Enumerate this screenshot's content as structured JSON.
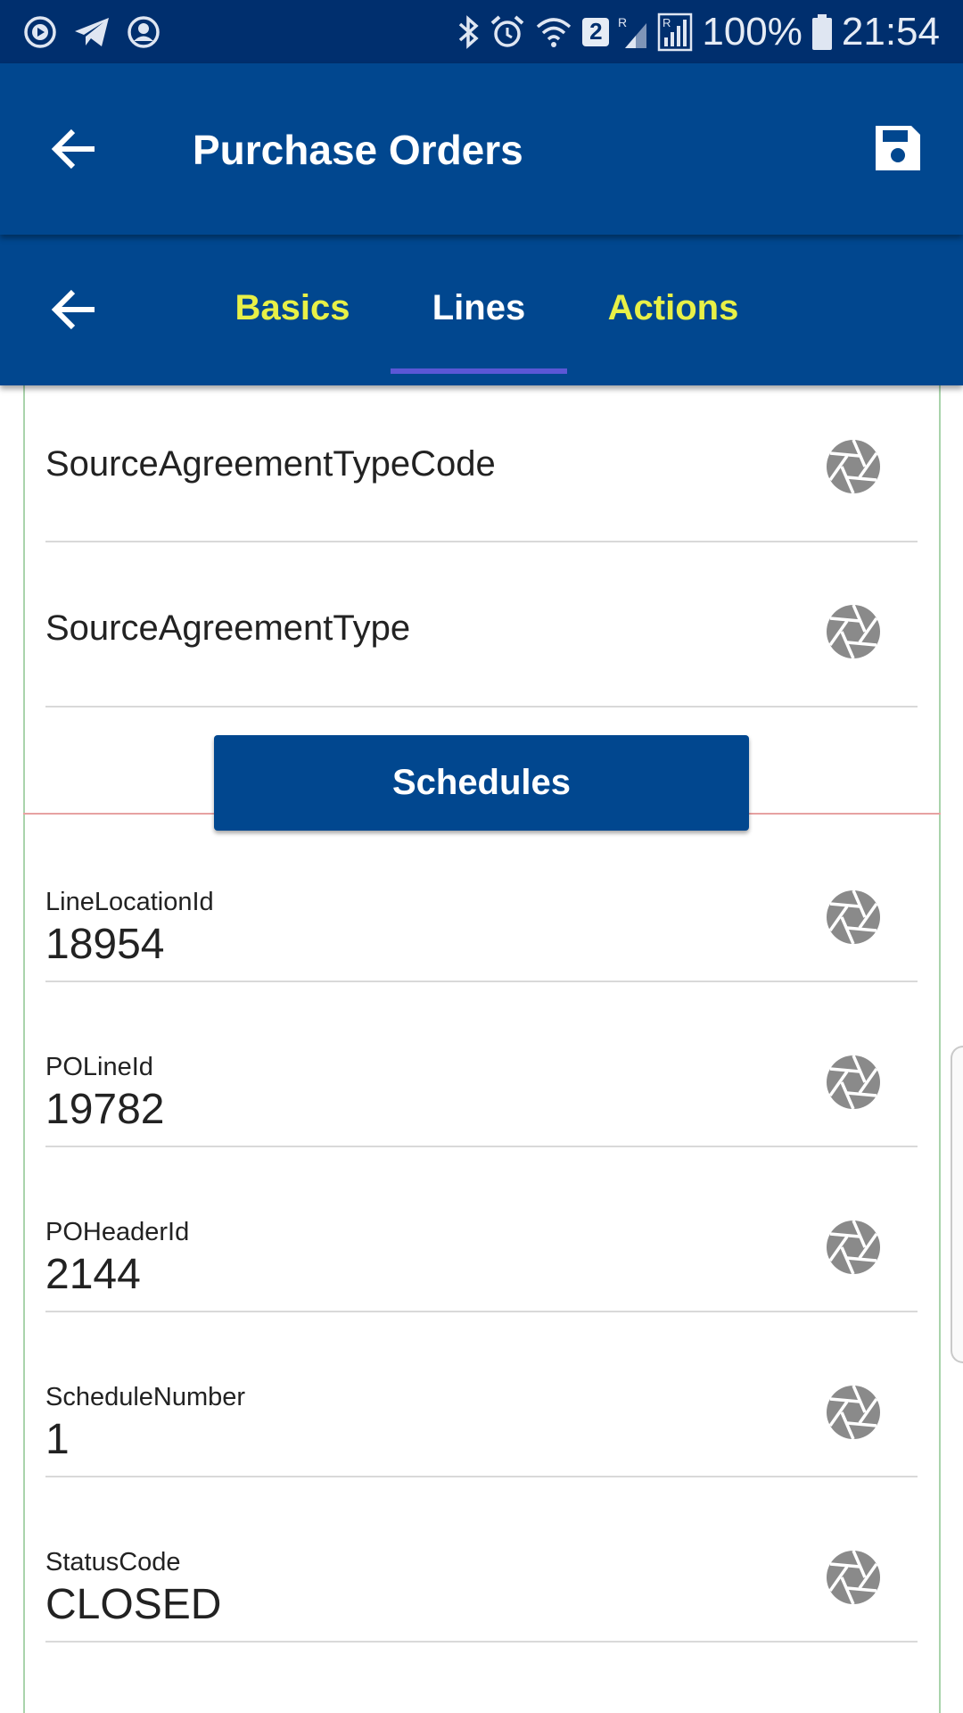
{
  "status_bar": {
    "battery": "100%",
    "time": "21:54",
    "sim_badge": "2",
    "icons": [
      "play-icon",
      "telegram-icon",
      "account-icon",
      "bluetooth-icon",
      "alarm-icon",
      "wifi-icon",
      "signal-icon",
      "signal-roaming-icon",
      "battery-icon"
    ]
  },
  "app_bar": {
    "title": "Purchase Orders",
    "back_icon": "arrow-back-icon",
    "save_icon": "save-icon"
  },
  "tabs": {
    "items": [
      {
        "label": "Basics",
        "active": false
      },
      {
        "label": "Lines",
        "active": true
      },
      {
        "label": "Actions",
        "active": false
      }
    ],
    "active_color": "#ffffff",
    "inactive_color": "#e8f047",
    "indicator_color": "#5b57d6"
  },
  "line_fields": [
    {
      "label": "SourceAgreementTypeCode"
    },
    {
      "label": "SourceAgreementType"
    }
  ],
  "schedules_button": {
    "label": "Schedules"
  },
  "schedule_fields": [
    {
      "label": "LineLocationId",
      "value": "18954"
    },
    {
      "label": "POLineId",
      "value": "19782"
    },
    {
      "label": "POHeaderId",
      "value": "2144"
    },
    {
      "label": "ScheduleNumber",
      "value": "1"
    },
    {
      "label": "StatusCode",
      "value": "CLOSED"
    }
  ],
  "colors": {
    "status_bar": "#002f6e",
    "primary": "#01478f",
    "shutter_icon": "#8a8a8a"
  }
}
